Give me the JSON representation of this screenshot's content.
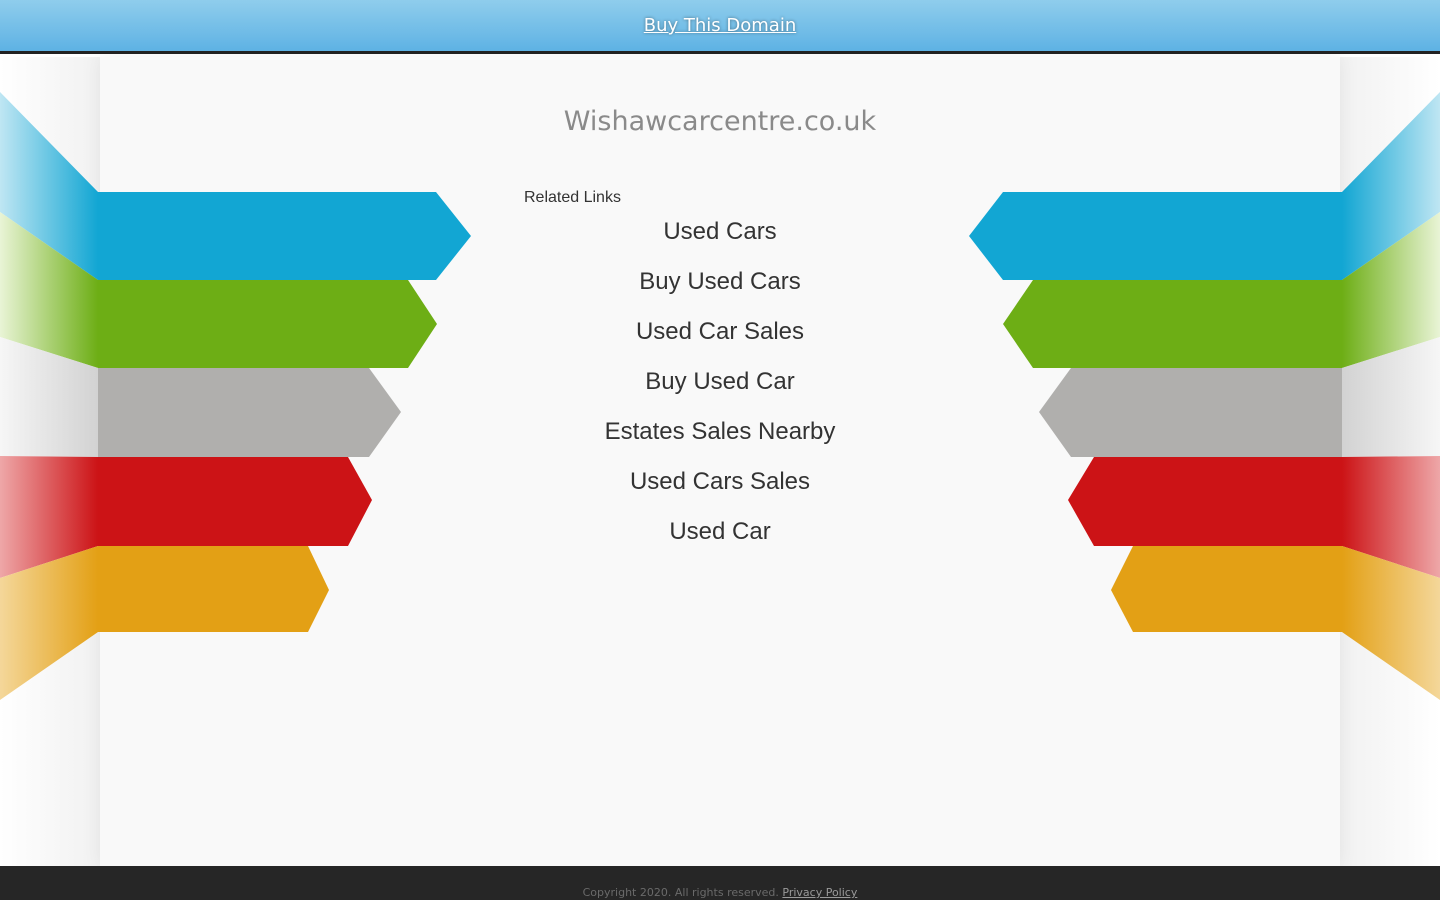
{
  "topbar": {
    "buy_label": "Buy This Domain"
  },
  "domain": {
    "name": "Wishawcarcentre.co.uk"
  },
  "related": {
    "label": "Related Links",
    "links": [
      "Used Cars",
      "Buy Used Cars",
      "Used Car Sales",
      "Buy Used Car",
      "Estates Sales Nearby",
      "Used Cars Sales",
      "Used Car"
    ]
  },
  "footer": {
    "copyright": "Copyright 2020. All rights reserved.",
    "privacy_label": "Privacy Policy"
  },
  "colors": {
    "blue": "#12a6d3",
    "green": "#6dae15",
    "gray": "#b0afad",
    "red": "#cc1316",
    "orange": "#e3a015"
  }
}
